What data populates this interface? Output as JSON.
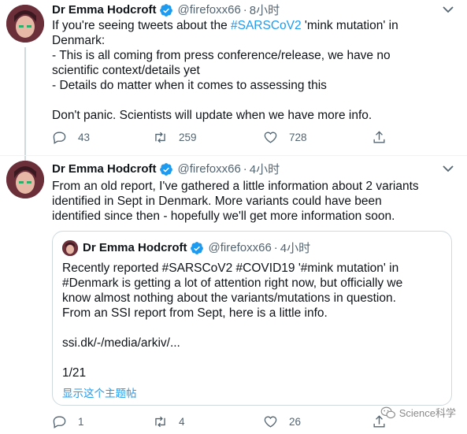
{
  "tweet1": {
    "name": "Dr Emma Hodcroft",
    "handle": "@firefoxx66",
    "dot": "·",
    "time": "8小时",
    "lines": [
      {
        "pre": "If you're seeing tweets about the ",
        "hashtag": "#SARSCoV2",
        "post": " 'mink mutation' in"
      },
      {
        "pre": "Denmark:",
        "hashtag": "",
        "post": ""
      },
      {
        "pre": "- This is all coming from press conference/release, we have no",
        "hashtag": "",
        "post": ""
      },
      {
        "pre": "scientific context/details yet",
        "hashtag": "",
        "post": ""
      },
      {
        "pre": "- Details do matter when it comes to assessing this",
        "hashtag": "",
        "post": ""
      }
    ],
    "line_after": "Don't panic. Scientists will update when we have more info.",
    "replies": "43",
    "retweets": "259",
    "likes": "728"
  },
  "tweet2": {
    "name": "Dr Emma Hodcroft",
    "handle": "@firefoxx66",
    "dot": "·",
    "time": "4小时",
    "text": "From an old report, I've gathered a little information about 2 variants\nidentified in Sept in Denmark. More variants could have been\nidentified since then - hopefully we'll get more information soon.",
    "replies": "1",
    "retweets": "4",
    "likes": "26"
  },
  "quote": {
    "name": "Dr Emma Hodcroft",
    "handle": "@firefoxx66",
    "dot": "·",
    "time": "4小时",
    "text": "Recently reported #SARSCoV2 #COVID19 '#mink mutation' in\n#Denmark is getting a lot of attention right now, but officially we\nknow almost nothing about the variants/mutations in question.\nFrom an SSI report from Sept, here is a little info.",
    "link": "ssi.dk/-/media/arkiv/...",
    "counter": "1/21",
    "show_thread": "显示这个主题帖"
  },
  "watermark": "Science科学",
  "colors": {
    "accent": "#1d9bf0",
    "muted": "#536471",
    "border": "#cfd9de"
  },
  "icons": [
    "verified-badge-icon",
    "more-icon",
    "reply-icon",
    "retweet-icon",
    "like-icon",
    "share-icon",
    "wechat-icon"
  ]
}
